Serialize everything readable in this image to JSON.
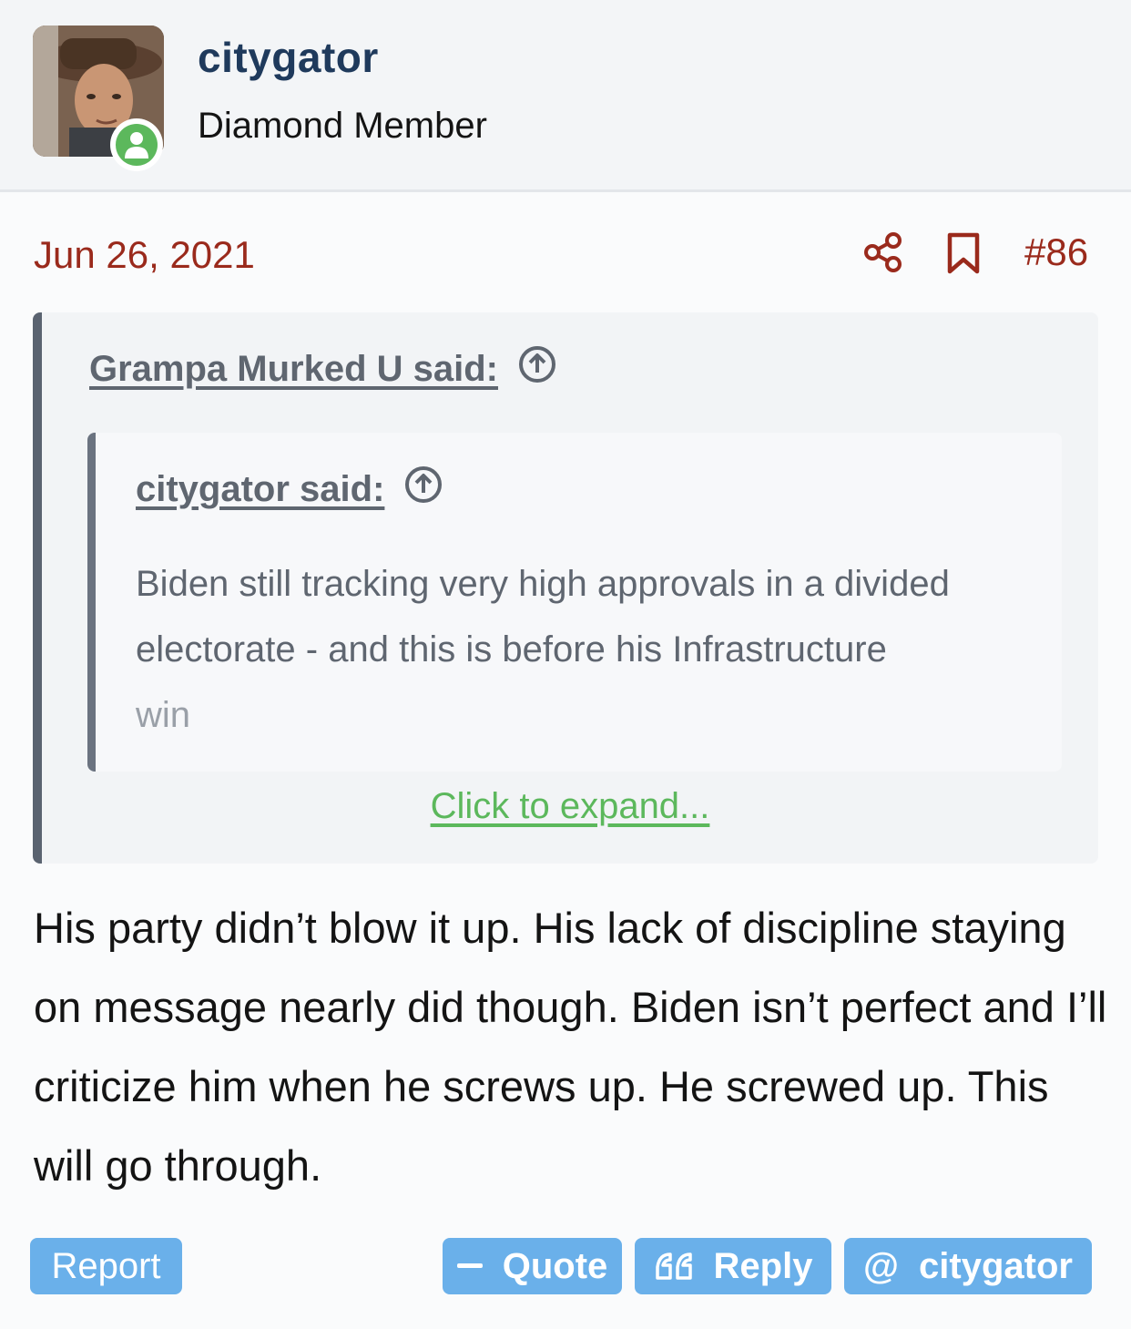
{
  "user": {
    "name": "citygator",
    "title": "Diamond Member"
  },
  "post": {
    "date": "Jun 26, 2021",
    "number": "#86",
    "body": "His party didn’t blow it up. His lack of discipline staying on message nearly did though. Biden isn’t perfect and I’ll criticize him when he screws up. He screwed up. This will go through."
  },
  "quote_outer": {
    "attribution": "Grampa Murked U said:"
  },
  "quote_inner": {
    "attribution": "citygator said:",
    "text_line1": "Biden still tracking very high approvals in a divided",
    "text_line2": "electorate - and this is before his Infrastructure",
    "text_line3": "win"
  },
  "expand_label": "Click to expand...",
  "actions": {
    "report": "Report",
    "quote": "Quote",
    "reply": "Reply",
    "mention": "citygator"
  },
  "icons": {
    "share": "share-icon",
    "bookmark": "bookmark-icon",
    "jump": "arrow-up-circle-icon",
    "online": "user-online-icon"
  },
  "colors": {
    "accent_red": "#9a2a1c",
    "username_blue": "#1f3a5c",
    "button_blue": "#6ab0ea",
    "online_green": "#5cb85c",
    "expand_green": "#5cb85c"
  }
}
